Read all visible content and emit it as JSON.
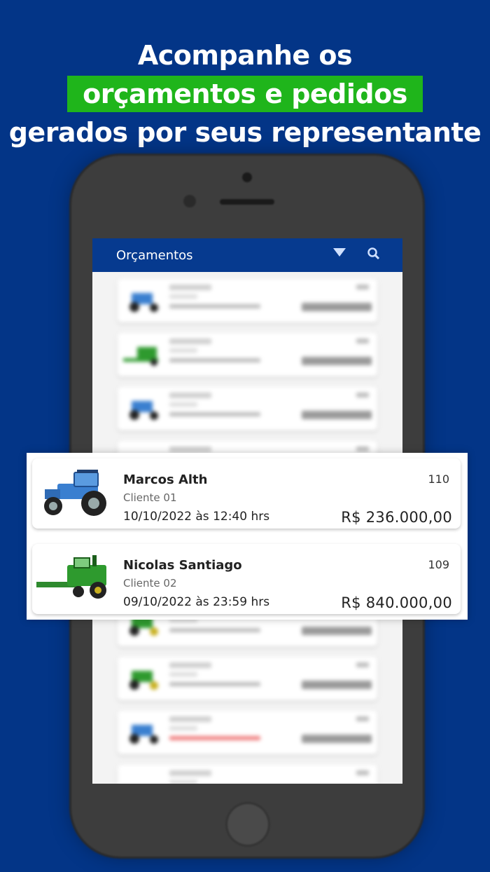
{
  "headline": {
    "line1": "Acompanhe os",
    "line2": "orçamentos e pedidos",
    "line3": "gerados por seus representante"
  },
  "app": {
    "title": "Orçamentos",
    "icons": [
      "filter-icon",
      "search-icon"
    ]
  },
  "highlight_cards": [
    {
      "name": "Marcos Alth",
      "client": "Cliente 01",
      "datetime": "10/10/2022 às 12:40 hrs",
      "number": "110",
      "value": "R$ 236.000,00",
      "vehicle": "tractor-blue"
    },
    {
      "name": "Nicolas Santiago",
      "client": "Cliente 02",
      "datetime": "09/10/2022 às 23:59 hrs",
      "number": "109",
      "value": "R$ 840.000,00",
      "vehicle": "harvester-green"
    }
  ],
  "colors": {
    "background": "#033587",
    "highlight": "#1fb51b",
    "appbar": "#063a8f",
    "tractor_blue": "#3a7fd0",
    "tractor_green": "#2e9a2e"
  }
}
